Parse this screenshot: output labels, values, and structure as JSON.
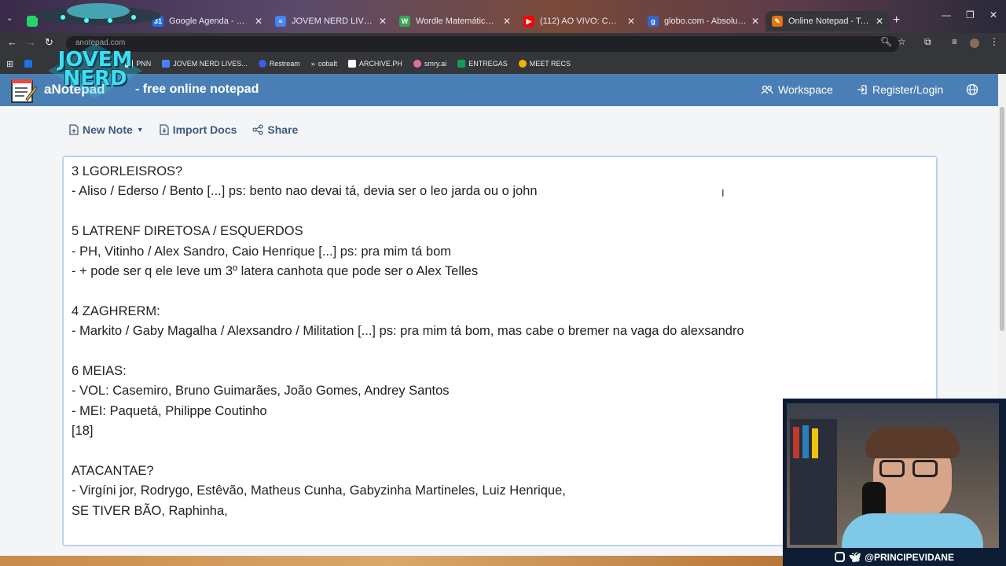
{
  "browser": {
    "tabs": [
      {
        "title": "",
        "fav_color": "#25d366",
        "fav_text": ""
      },
      {
        "title": "Google Agenda - Semana de 2",
        "fav_color": "#1a73e8",
        "fav_text": "31"
      },
      {
        "title": "JOVEM NERD LIVES - PAUTA - ",
        "fav_color": "#4285f4",
        "fav_text": "≡"
      },
      {
        "title": "Wordle Matemático - Wordle c",
        "fav_color": "#34a853",
        "fav_text": "W"
      },
      {
        "title": "(112) AO VIVO: CONVOCAÇÃO",
        "fav_color": "#ff0000",
        "fav_text": "▶"
      },
      {
        "title": "globo.com - Absolutamente tu",
        "fav_color": "#3366cc",
        "fav_text": "g"
      },
      {
        "title": "Online Notepad - Take Notes o",
        "fav_color": "#e8710a",
        "fav_text": "✎"
      }
    ],
    "omnibox_text": "anotepad.com",
    "bookmarks": [
      {
        "label": "PNN",
        "color": "#ffffff"
      },
      {
        "label": "JOVEM NERD LIVES...",
        "color": "#4285f4"
      },
      {
        "label": "Restream",
        "color": "#3c5de6"
      },
      {
        "label": "cobalt",
        "color": "#e8eaed"
      },
      {
        "label": "ARCHIVE.PH",
        "color": "#ffffff"
      },
      {
        "label": "smry.ai",
        "color": "#e36aa8"
      },
      {
        "label": "ENTREGAS",
        "color": "#0f9d58"
      },
      {
        "label": "MEET RECS",
        "color": "#f4b400"
      }
    ]
  },
  "site": {
    "title": "aNotepad",
    "subtitle": "- free online notepad",
    "workspace": "Workspace",
    "register": "Register/Login",
    "new_note": "New Note",
    "import_docs": "Import Docs",
    "share": "Share",
    "header_color": "#4a7fb5"
  },
  "note": {
    "lines": [
      "3 LGORLEISROS?",
      "- Aliso / Ederso / Bento [...] ps: bento nao devai tá, devia ser o leo jarda ou o john",
      "",
      "5 LATRENF DIRETOSA / ESQUERDOS",
      "- PH, Vitinho / Alex Sandro, Caio Henrique [...] ps: pra mim tá bom",
      "- + pode ser q ele leve um 3º latera canhota que pode ser o Alex Telles",
      "",
      "4 ZAGHRERM:",
      "- Markito / Gaby Magalha / Alexsandro / Militation [...] ps: pra mim tá bom, mas cabe o bremer na vaga do alexsandro",
      "",
      "6 MEIAS:",
      "- VOL: Casemiro, Bruno Guimarães, João Gomes, Andrey Santos",
      "- MEI: Paquetá, Philippe Coutinho",
      "[18]",
      "",
      "ATACANTAE?",
      "- Virgíni jor, Rodrygo, Estêvão, Matheus Cunha, Gabyzinha Martineles, Luiz Henrique,",
      "SE TIVER BÃO, Raphinha,"
    ]
  },
  "overlay": {
    "logo_text": "JOVEM NERD",
    "handle": "@PRINCIPEVIDANE"
  }
}
